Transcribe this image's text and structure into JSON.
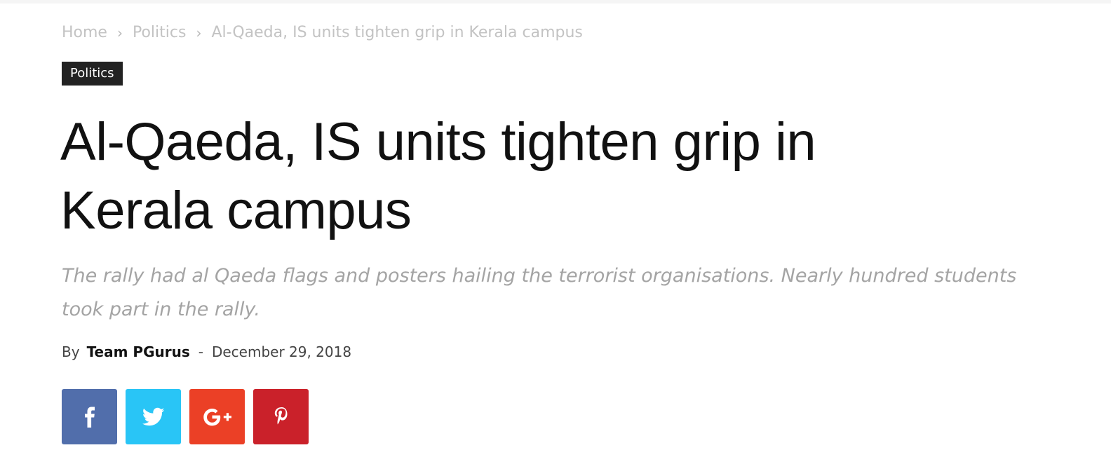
{
  "breadcrumb": {
    "home": "Home",
    "section": "Politics",
    "current": "Al-Qaeda, IS units tighten grip in Kerala campus",
    "separator": "›"
  },
  "category": "Politics",
  "article": {
    "title": "Al-Qaeda, IS units tighten grip in Kerala campus",
    "subtitle": "The rally had al Qaeda flags and posters hailing the terrorist organisations. Nearly hundred students took part in the rally.",
    "by_label": "By",
    "author": "Team PGurus",
    "separator": "-",
    "date": "December 29, 2018"
  },
  "share": {
    "buttons": [
      {
        "name": "facebook",
        "icon": "facebook-icon",
        "color": "#516eab"
      },
      {
        "name": "twitter",
        "icon": "twitter-icon",
        "color": "#29c5f6"
      },
      {
        "name": "googleplus",
        "icon": "googleplus-icon",
        "color": "#eb4026"
      },
      {
        "name": "pinterest",
        "icon": "pinterest-icon",
        "color": "#ca212a"
      }
    ]
  },
  "colors": {
    "category_bg": "#222222",
    "title": "#111111",
    "subtitle": "#a4a4a4",
    "breadcrumb": "#c3c3c3"
  }
}
